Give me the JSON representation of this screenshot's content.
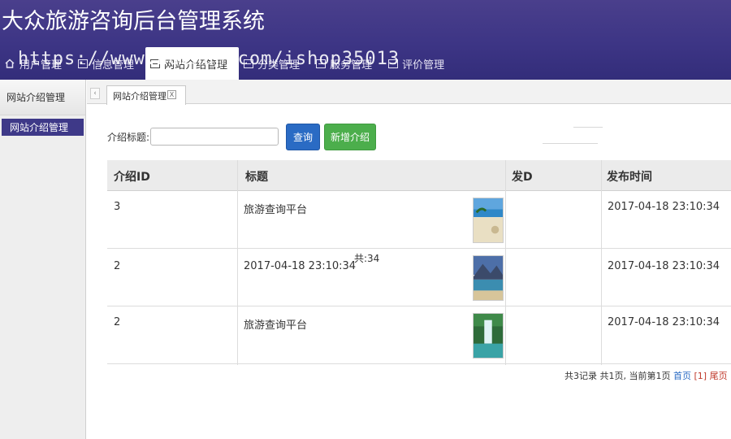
{
  "app": {
    "title": "大众旅游咨询后台管理系统"
  },
  "nav": {
    "items": [
      {
        "label": "用户管理",
        "icon": "home-icon"
      },
      {
        "label": "信息管理",
        "icon": "list-icon"
      },
      {
        "label": "网站介绍管理",
        "icon": "list-icon"
      },
      {
        "label": "分类管理",
        "icon": "list-icon"
      },
      {
        "label": "服务管理",
        "icon": "list-icon"
      },
      {
        "label": "评价管理",
        "icon": "list-icon"
      }
    ]
  },
  "watermark": "https://www.huzhan.com/ishop35013",
  "sidebar": {
    "header": "网站介绍管理",
    "items": [
      {
        "label": "网站介绍管理"
      }
    ]
  },
  "tabs": {
    "active_label": "网站介绍管理",
    "close_glyph": "X",
    "scroll_glyph": "‹"
  },
  "search": {
    "label": "介绍标题:",
    "value": "",
    "query_button": "查询",
    "add_button": "新增介绍"
  },
  "table": {
    "columns": [
      "介绍ID",
      "标题",
      "发D",
      "发布时间"
    ],
    "rows": [
      {
        "id": "3",
        "title": "旅游查询平台",
        "time": "2017-04-18 23:10:34",
        "thumb": "beach-photo"
      },
      {
        "id": "2",
        "title": "2017-04-18 23:10:34",
        "time": "2017-04-18 23:10:34",
        "thumb": "lake-mountain-photo"
      },
      {
        "id": "2",
        "title": "旅游查询平台",
        "time": "2017-04-18 23:10:34",
        "thumb": "waterfall-photo"
      }
    ],
    "stray_text": "共:34"
  },
  "pager": {
    "summary": "共3记录 共1页, 当前第1页",
    "first": "首页",
    "current": "[1]",
    "last": "尾页"
  },
  "colors": {
    "header": "#3d3585",
    "active_side": "#3e3988",
    "query_btn": "#2a6bc4",
    "add_btn": "#4cae4c"
  }
}
